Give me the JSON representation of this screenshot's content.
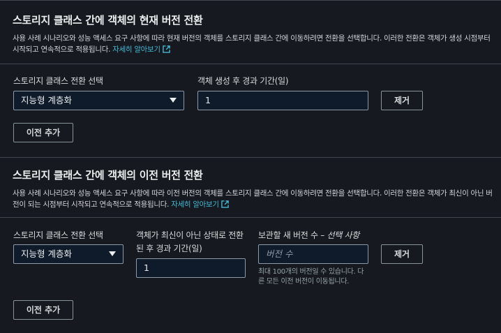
{
  "current": {
    "title": "스토리지 클래스 간에 객체의 현재 버전 전환",
    "desc_line1": "사용 사례 시나리오와 성능 액세스 요구 사항에 따라 현재 버전의 객체를 스토리지 클래스 간에 이동하려면 전환을 선택합니다. 이러한 전환은 객체가 생성 시점부터",
    "desc_line2": "시작되고 연속적으로 적용됩니다.",
    "learn_more": "자세히 알아보기",
    "storage_class_label": "스토리지 클래스 전환 선택",
    "storage_class_value": "지능형 계층화",
    "days_label": "객체 생성 후 경과 기간(일)",
    "days_value": "1",
    "remove_label": "제거",
    "add_label": "이전 추가"
  },
  "noncurrent": {
    "title": "스토리지 클래스 간에 객체의 이전 버전 전환",
    "desc_line1": "사용 사례 시나리오와 성능 액세스 요구 사항에 따라 이전 버전의 객체를 스토리지 클래스 간에 이동하려면 전환을 선택합니다. 이러한 전환은 객체가 최신이 아닌 버",
    "desc_line2": "전이 되는 시점부터 시작되고 연속적으로 적용됩니다.",
    "learn_more": "자세히 알아보기",
    "storage_class_label": "스토리지 클래스 전환 선택",
    "storage_class_value": "지능형 계층화",
    "days_label_line1": "객체가 최신이 아닌 상태로 전환",
    "days_label_line2": "된 후 경과 기간(일)",
    "days_value": "1",
    "versions_label": "보관할 새 버전 수 – ",
    "versions_optional": "선택 사항",
    "versions_placeholder": "버전 수",
    "versions_hint_line1": "최대 100개의 버전일 수 있습니다. 다",
    "versions_hint_line2": "른 모든 이전 버전이 이동됩니다.",
    "remove_label": "제거",
    "add_label": "이전 추가"
  },
  "colors": {
    "background": "#16191f",
    "link": "#44b9d6",
    "border": "#414750"
  }
}
